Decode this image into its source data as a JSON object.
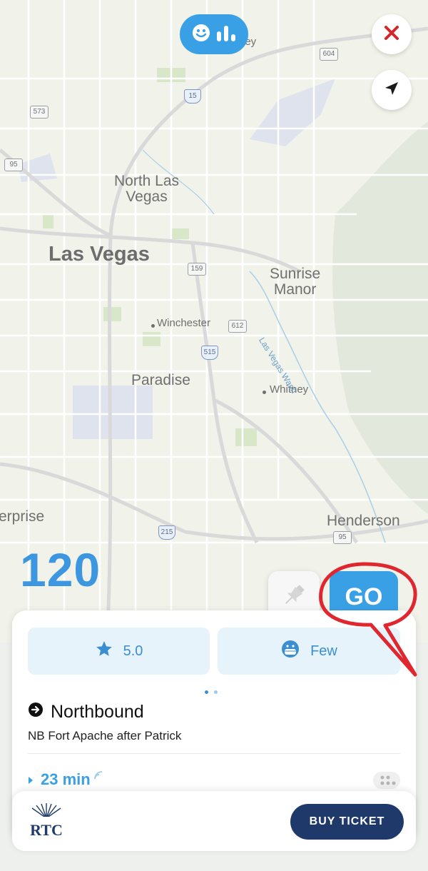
{
  "map": {
    "places_big": [
      "Las Vegas"
    ],
    "places_medium": [
      "North Las\nVegas",
      "Sunrise\nManor",
      "Paradise",
      "Henderson"
    ],
    "places_small": [
      "Winchester",
      "Whitney",
      "Las Vegas Wash"
    ],
    "places_cut": [
      "erprise",
      "ley"
    ],
    "route_shields": [
      "15",
      "573",
      "95",
      "159",
      "612",
      "515",
      "215",
      "95",
      "604"
    ]
  },
  "rate_icons": [
    "smile-icon",
    "bar-chart-icon"
  ],
  "close_icon": "close-icon",
  "locate_icon": "location-arrow-icon",
  "route_number": "120",
  "pin_icon": "pin-icon",
  "go_label": "GO",
  "card": {
    "rating": "5.0",
    "crowding": "Few",
    "direction": "Northbound",
    "stop_name": "NB Fort Apache after Patrick",
    "eta": "23 min"
  },
  "bottom": {
    "logo_text": "RTC",
    "buy_label": "BUY TICKET"
  },
  "colors": {
    "accent": "#3aa0e6",
    "navy": "#1f3a6a",
    "close_red": "#d3262a",
    "callout_red": "#e0262e"
  }
}
